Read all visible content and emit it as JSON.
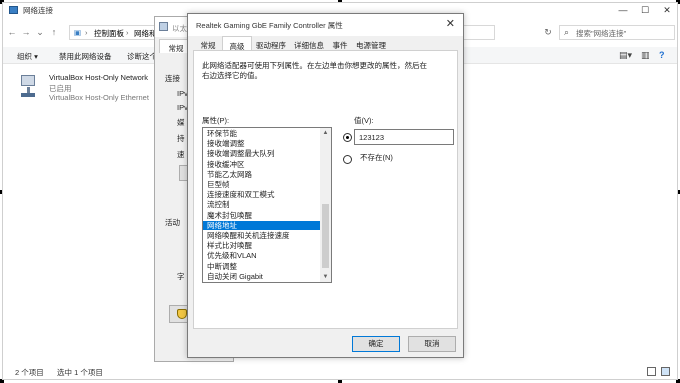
{
  "explorer": {
    "title": "网络连接",
    "path": [
      "控制面板",
      "网络和"
    ],
    "search_placeholder": "搜索\"网络连接\"",
    "toolbar": [
      "组织",
      "禁用此网络设备",
      "诊断这个"
    ],
    "adapter": {
      "name": "VirtualBox Host-Only Network",
      "status": "已启用",
      "device": "VirtualBox Host-Only Ethernet"
    },
    "status": {
      "count": "2 个项目",
      "selected": "选中 1 个项目"
    }
  },
  "bg_dialog": {
    "title": "以太",
    "tab": "常规",
    "labels": {
      "connect": "连接",
      "l1": "IPv",
      "l2": "IPv",
      "l3": "媒",
      "l4": "持",
      "l5": "速",
      "activity": "活动",
      "bytes": "字"
    }
  },
  "dialog": {
    "title": "Realtek Gaming GbE Family Controller 属性",
    "close": "✕",
    "tabs": [
      "常规",
      "高级",
      "驱动程序",
      "详细信息",
      "事件",
      "电源管理"
    ],
    "active_tab": "高级",
    "description": "此网络适配器可使用下列属性。在左边单击你想更改的属性，然后在右边选择它的值。",
    "property_label": "属性(P):",
    "value_label": "值(V):",
    "properties": [
      "环保节能",
      "接收端调整",
      "接收端调整最大队列",
      "接收缓冲区",
      "节能乙太网路",
      "巨型帧",
      "连接速度和双工模式",
      "流控制",
      "魔术封包唤醒",
      "网络地址",
      "网络唤醒和关机连接速度",
      "样式比对唤醒",
      "优先级和VLAN",
      "中断调整",
      "自动关闭 Gigabit"
    ],
    "selected_property": "网络地址",
    "value": "123123",
    "not_present_label": "不存在(N)",
    "ok_label": "确定",
    "cancel_label": "取消"
  }
}
